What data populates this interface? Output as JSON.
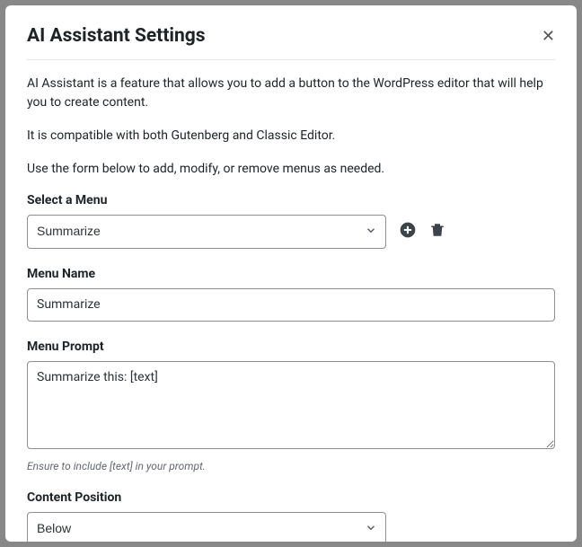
{
  "modal": {
    "title": "AI Assistant Settings"
  },
  "intro": {
    "p1": "AI Assistant is a feature that allows you to add a button to the WordPress editor that will help you to create content.",
    "p2": "It is compatible with both Gutenberg and Classic Editor.",
    "p3": "Use the form below to add, modify, or remove menus as needed."
  },
  "selectMenu": {
    "label": "Select a Menu",
    "value": "Summarize"
  },
  "menuName": {
    "label": "Menu Name",
    "value": "Summarize"
  },
  "menuPrompt": {
    "label": "Menu Prompt",
    "value": "Summarize this: [text]",
    "hint": "Ensure to include [text] in your prompt."
  },
  "contentPosition": {
    "label": "Content Position",
    "value": "Below"
  }
}
